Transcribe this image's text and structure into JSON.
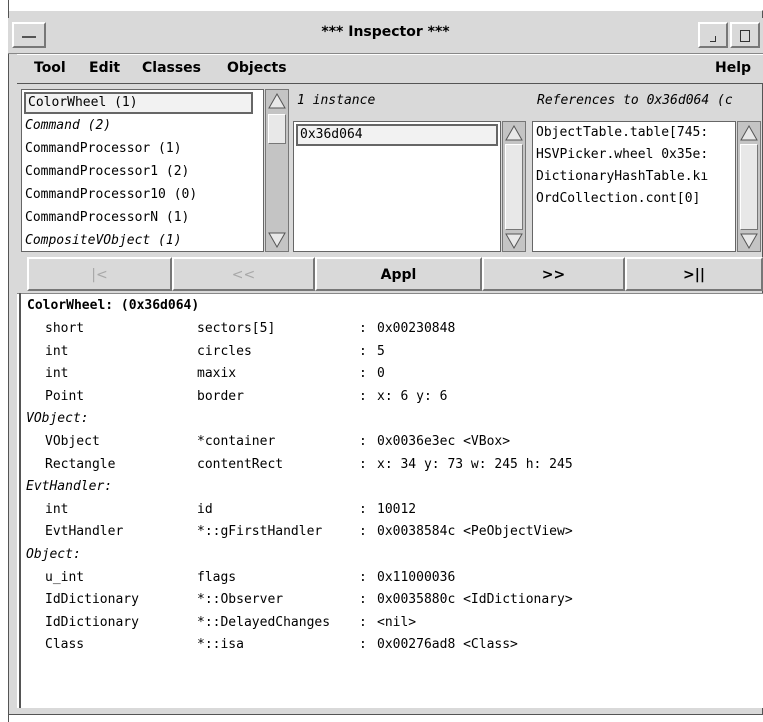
{
  "window": {
    "title": "*** Inspector ***"
  },
  "menu": [
    "Tool",
    "Edit",
    "Classes",
    "Objects"
  ],
  "help_menu": "Help",
  "class_list": [
    {
      "label": "ColorWheel (1)",
      "italic": false,
      "selected": true
    },
    {
      "label": "Command (2)",
      "italic": true,
      "selected": false
    },
    {
      "label": "CommandProcessor (1)",
      "italic": false,
      "selected": false
    },
    {
      "label": "CommandProcessor1 (2)",
      "italic": false,
      "selected": false
    },
    {
      "label": "CommandProcessor10 (0)",
      "italic": false,
      "selected": false
    },
    {
      "label": "CommandProcessorN (1)",
      "italic": false,
      "selected": false
    },
    {
      "label": "CompositeVObject (1)",
      "italic": true,
      "selected": false
    }
  ],
  "instances": {
    "header": "1 instance",
    "items": [
      "0x36d064"
    ]
  },
  "references": {
    "header": "References to 0x36d064 (c",
    "items": [
      "ObjectTable.table[745:",
      "HSVPicker.wheel 0x35e:",
      "DictionaryHashTable.kı",
      "OrdCollection.cont[0]"
    ]
  },
  "nav": {
    "first": "|<",
    "prev": "<<",
    "appl": "Appl",
    "next": ">>",
    "last": ">||"
  },
  "detail": {
    "header": "ColorWheel: (0x36d064)",
    "rows": [
      {
        "kind": "field",
        "type": "short",
        "name": "sectors[5]",
        "value": "0x00230848"
      },
      {
        "kind": "field",
        "type": "int",
        "name": "circles",
        "value": "5"
      },
      {
        "kind": "field",
        "type": "int",
        "name": "maxix",
        "value": "0"
      },
      {
        "kind": "field",
        "type": "Point",
        "name": "border",
        "value": "x: 6 y: 6"
      },
      {
        "kind": "section",
        "label": "VObject:"
      },
      {
        "kind": "field",
        "type": "VObject",
        "name": "*container",
        "value": "0x0036e3ec <VBox>"
      },
      {
        "kind": "field",
        "type": "Rectangle",
        "name": "contentRect",
        "value": "x: 34 y: 73 w: 245 h: 245"
      },
      {
        "kind": "section",
        "label": "EvtHandler:"
      },
      {
        "kind": "field",
        "type": "int",
        "name": "id",
        "value": "10012"
      },
      {
        "kind": "field",
        "type": "EvtHandler",
        "name": "*::gFirstHandler",
        "value": "0x0038584c <PeObjectView>"
      },
      {
        "kind": "section",
        "label": "Object:"
      },
      {
        "kind": "field",
        "type": "u_int",
        "name": "flags",
        "value": "0x11000036"
      },
      {
        "kind": "field",
        "type": "IdDictionary",
        "name": "*::Observer",
        "value": "0x0035880c <IdDictionary>"
      },
      {
        "kind": "field",
        "type": "IdDictionary",
        "name": "*::DelayedChanges",
        "value": "<nil>"
      },
      {
        "kind": "field",
        "type": "Class",
        "name": "*::isa",
        "value": "0x00276ad8 <Class>"
      }
    ],
    "separator": ":"
  },
  "colors": {
    "chrome": "#d9d9d9",
    "pane": "#ffffff",
    "disabled_text": "#a8a8a8"
  }
}
